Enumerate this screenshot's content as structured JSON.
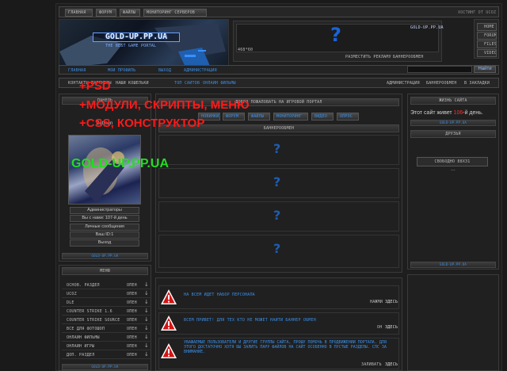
{
  "top_nav": {
    "items": [
      "ГЛАВНАЯ",
      "ФОРУМ",
      "ФАЙЛЫ",
      "МОНИТОРИНГ СЕРВЕРОВ"
    ],
    "hosting": "ХОСТИНГ ОТ UCOZ"
  },
  "logo": {
    "title": "GOLD-UP.PP.UA",
    "slogan": "THE BEST GAME PORTAL"
  },
  "banner": {
    "site": "GOLD-UP.PP.UA",
    "code": "468*60",
    "place_ad": "РАЗМЕСТИТЬ РЕКЛАМУ",
    "banners": "БАННЕРООБМЕН",
    "question_mark": "?"
  },
  "right_nav": [
    "HOME",
    "FORUM",
    "FILES",
    "VIDEOS"
  ],
  "nav2": {
    "items": [
      "ГЛАВНАЯ",
      "МОЙ ПРОФИЛЬ",
      "ВЫХОД",
      "АДМИНИСТРАЦИЯ"
    ],
    "search_button": "Найти"
  },
  "subnav": {
    "left": [
      "КОНТАКТЫ",
      "ПАРТНЕРЫ",
      "НАШИ КОШЕЛЬКИ",
      "ТОП САЙТОВ",
      "ОНЛАЙН ФИЛЬМЫ"
    ],
    "right": [
      "АДМИНИСТРАЦИЯ",
      "БАННЕРООБМЕН",
      "В ЗАКЛАДКИ"
    ]
  },
  "user_panel": {
    "header": "ПАНЕЛЬ",
    "username": "Batman",
    "rows": [
      "Администраторы",
      "Вы с нами: 107-й день",
      "Личные сообщения",
      "Ваш ID:1",
      "Выход"
    ],
    "footer": "GOLD-UP.PP.UA"
  },
  "center": {
    "welcome": "ДОБРО ПОЖАЛОВАТЬ НА ИГРОВОЙ ПОРТАЛ",
    "tabs": [
      "НОВИНКИ",
      "ФОРУМ",
      "ФАЙЛЫ",
      "МОНИТОРИНГ",
      "ВИДЕО",
      "ОПРОС"
    ],
    "banner_label": "БАННЕРООБМЕН",
    "question": "?"
  },
  "overlays": {
    "line1": "+PSD",
    "line2": "+МОДУЛИ, СКРИПТЫ, МЕНЮ",
    "line3": "+CSS, КОНСТРУКТОР",
    "line4": "GOLD-UP.PP.UA",
    "color_red": "#ff1a1a",
    "color_green": "#22dd22"
  },
  "right_panel": {
    "stats_header": "ЖИЗНЬ САЙТА",
    "live_prefix": "Этот сайт живет ",
    "live_days": "106",
    "live_suffix": "-й день.",
    "footer1": "GOLD-UP.PP.UA",
    "friends_header": "ДРУЗЬЯ",
    "free_slot": "СВОБОДНО 88Х31",
    "dots": "...",
    "footer2": "GOLD-UP.PP.UA"
  },
  "menu": {
    "header": "МЕНЮ",
    "items": [
      {
        "label": "ОСНОВ. РАЗДЕЛ",
        "state": "ОПЕН"
      },
      {
        "label": "UCOZ",
        "state": "ОПЕН"
      },
      {
        "label": "DLE",
        "state": "ОПЕН"
      },
      {
        "label": "COUNTER STRIKE 1.6",
        "state": "ОПЕН"
      },
      {
        "label": "COUNTER STRIKE SOURCE",
        "state": "ОПЕН"
      },
      {
        "label": "ВСЁ ДЛЯ ФОТОШОП",
        "state": "ОПЕН"
      },
      {
        "label": "ОНЛАЙН ФИЛЬМЫ",
        "state": "ОПЕН"
      },
      {
        "label": "ОНЛАЙН ИГРЫ",
        "state": "ОПЕН"
      },
      {
        "label": "ДОП. РАЗДЕЛ",
        "state": "ОПЕН"
      }
    ],
    "arrow": "↓",
    "footer": "GOLD-UP.PP.UA"
  },
  "news": [
    {
      "text": "НА ВСЕМ ИДЁТ НАБОР ПЕРСОНАЛА",
      "link_prefix": "НАЖМИ",
      "link": "ЗДЕСЬ"
    },
    {
      "text": "ВСЕМ ПРИВЕТ! ДЛЯ ТЕХ КТО НЕ МОЖЕТ НАЙТИ БАННЕР ОБМЕН",
      "link_prefix": "ОН",
      "link": "ЗДЕСЬ"
    },
    {
      "text": "УВАЖАЕМЫЕ ПОЛЬЗОВАТЕЛИ И ДРУГИЕ ГРУППЫ САЙТА, ПРОШУ ПОМОЧЬ В ПРОДВИЖЕНИИ ПОРТАЛА. ДЛЯ ЭТОГО ДОСТАТОЧНО ХОТЯ БЫ ЗАЛИТЬ ПАРУ ФАЙЛОВ НА САЙТ ОСОБЕННО В ПУСТЫЕ РАЗДЕЛЫ. СПС ЗА ВНИМАНИЕ.",
      "link_prefix": "ЗАЛИВАТЬ",
      "link": "ЗДЕСЬ"
    }
  ]
}
